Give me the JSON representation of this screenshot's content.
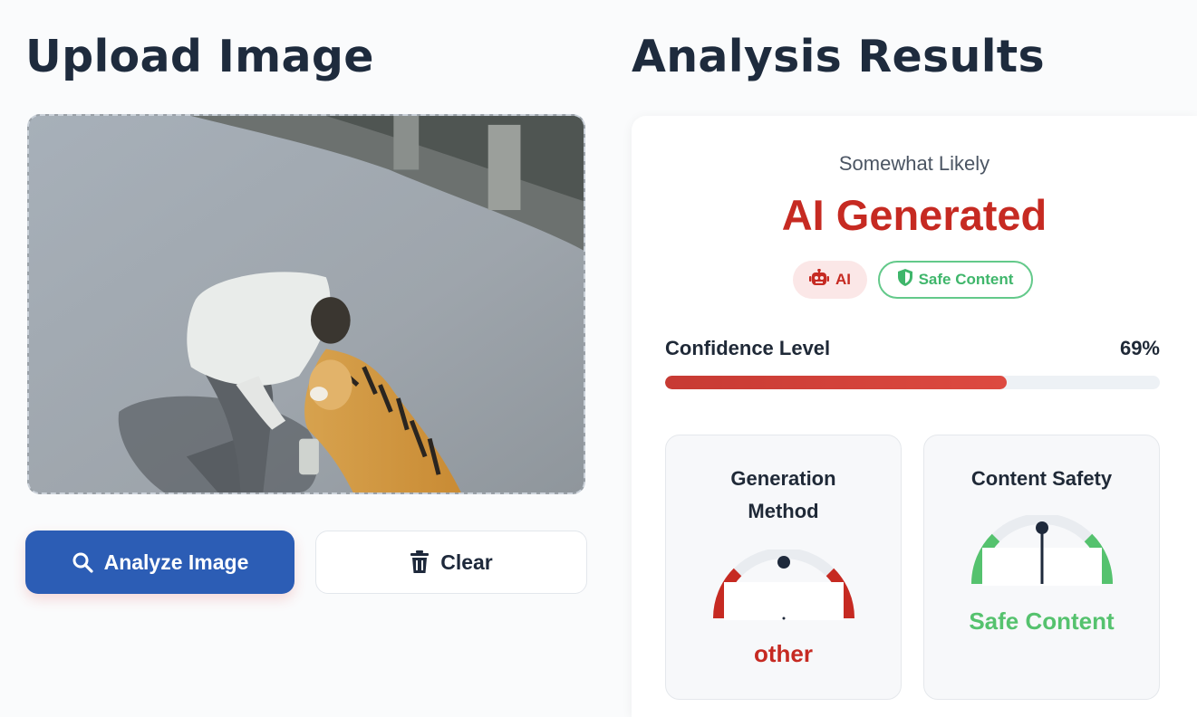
{
  "upload": {
    "title": "Upload Image",
    "analyze_label": "Analyze Image",
    "clear_label": "Clear"
  },
  "results": {
    "title": "Analysis Results",
    "likelihood": "Somewhat Likely",
    "verdict": "AI Generated",
    "badges": {
      "ai": "AI",
      "safe": "Safe Content"
    },
    "confidence": {
      "label": "Confidence Level",
      "value_text": "69%",
      "fraction": 0.69
    },
    "generation_method": {
      "title": "Generation Method",
      "value": "other"
    },
    "content_safety": {
      "title": "Content Safety",
      "value": "Safe Content"
    }
  },
  "colors": {
    "primary_button": "#2c5db5",
    "verdict_red": "#c62a22",
    "safe_green": "#55c26e",
    "heading": "#1e2b3d"
  },
  "icons": {
    "analyze": "search-icon",
    "clear": "trash-icon",
    "ai_badge": "robot-icon",
    "safe_badge": "shield-icon"
  }
}
